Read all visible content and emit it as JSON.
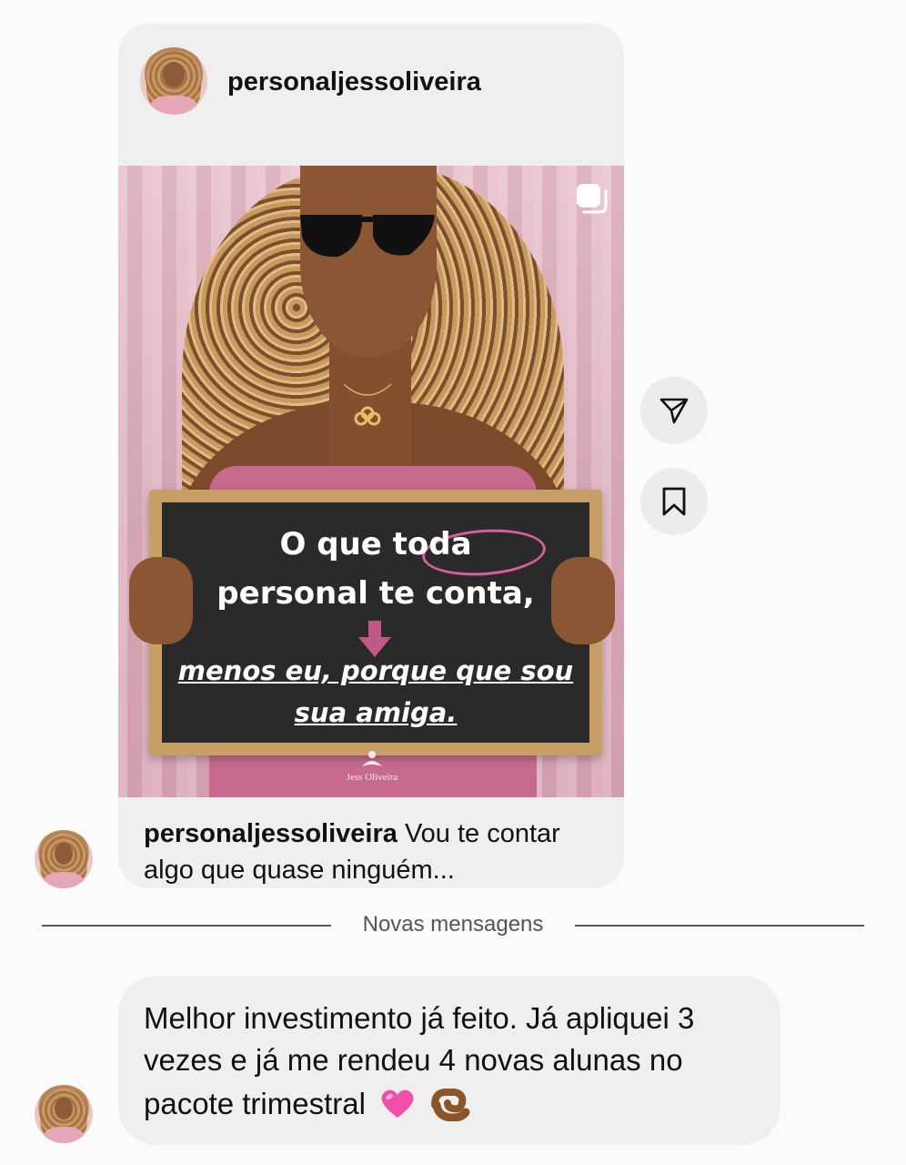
{
  "post": {
    "username": "personaljessoliveira",
    "image": {
      "board_line_1": "O que toda",
      "board_line_2": "personal te conta,",
      "board_line_3": "menos eu, porque que sou",
      "board_line_4": "sua amiga.",
      "brand_name": "Jess Oliveira"
    },
    "caption_user": "personaljessoliveira",
    "caption_text": "Vou te contar algo que quase ninguém..."
  },
  "actions": {
    "share_icon": "send-icon",
    "save_icon": "bookmark-icon"
  },
  "divider": {
    "label": "Novas mensagens"
  },
  "message": {
    "text": "Melhor investimento já feito. Já apliquei 3 vezes e já me rendeu 4 novas alunas no pacote trimestral",
    "emojis": [
      "pink-heart-icon",
      "ok-hand-icon"
    ]
  },
  "colors": {
    "bubble": "#efefef",
    "background": "#fbfbfb",
    "accent_pink": "#d6609a"
  }
}
